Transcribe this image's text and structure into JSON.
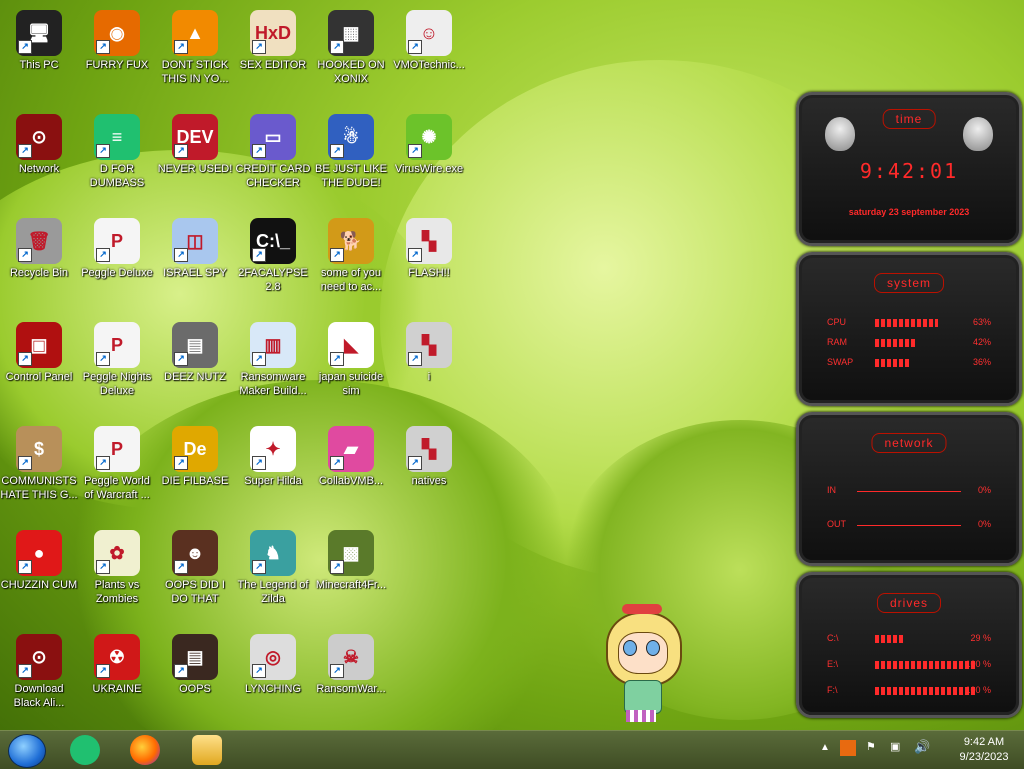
{
  "icons": [
    {
      "label": "This PC",
      "col": 0,
      "row": 0,
      "color": "#222",
      "glyph": "🖥"
    },
    {
      "label": "FURRY FUX",
      "col": 1,
      "row": 0,
      "color": "#e66a00",
      "glyph": "◉"
    },
    {
      "label": "DONT STICK THIS IN YO...",
      "col": 2,
      "row": 0,
      "color": "#f28a00",
      "glyph": "▲"
    },
    {
      "label": "SEX EDITOR",
      "col": 3,
      "row": 0,
      "color": "#f0e0c0",
      "glyph": "HxD"
    },
    {
      "label": "HOOKED ON XONIX",
      "col": 4,
      "row": 0,
      "color": "#333",
      "glyph": "▦"
    },
    {
      "label": "VMOTechnic...",
      "col": 5,
      "row": 0,
      "color": "#eee",
      "glyph": "☺"
    },
    {
      "label": "Network",
      "col": 0,
      "row": 1,
      "color": "#8a1010",
      "glyph": "⊙"
    },
    {
      "label": "D FOR DUMBASS",
      "col": 1,
      "row": 1,
      "color": "#20c070",
      "glyph": "≡"
    },
    {
      "label": "NEVER USED!",
      "col": 2,
      "row": 1,
      "color": "#c01a2a",
      "glyph": "DEV"
    },
    {
      "label": "CREDIT CARD CHECKER",
      "col": 3,
      "row": 1,
      "color": "#6a5acd",
      "glyph": "▭"
    },
    {
      "label": "BE JUST LIKE THE DUDE!",
      "col": 4,
      "row": 1,
      "color": "#3060c0",
      "glyph": "☃"
    },
    {
      "label": "VirusWire.exe",
      "col": 5,
      "row": 1,
      "color": "#6cc32a",
      "glyph": "✺"
    },
    {
      "label": "Recycle Bin",
      "col": 0,
      "row": 2,
      "color": "#9a9a9a",
      "glyph": "🗑"
    },
    {
      "label": "Peggle Deluxe",
      "col": 1,
      "row": 2,
      "color": "#f5f5f5",
      "glyph": "P"
    },
    {
      "label": "ISRAEL SPY",
      "col": 2,
      "row": 2,
      "color": "#a9c7ee",
      "glyph": "◫"
    },
    {
      "label": "2FACALYPSE 2.8",
      "col": 3,
      "row": 2,
      "color": "#111",
      "glyph": "C:\\_"
    },
    {
      "label": "some of you need to ac...",
      "col": 4,
      "row": 2,
      "color": "#d29a18",
      "glyph": "🐕"
    },
    {
      "label": "FLASH!!",
      "col": 5,
      "row": 2,
      "color": "#e8e8e8",
      "glyph": "▚"
    },
    {
      "label": "Control Panel",
      "col": 0,
      "row": 3,
      "color": "#b01010",
      "glyph": "▣"
    },
    {
      "label": "Peggle Nights Deluxe",
      "col": 1,
      "row": 3,
      "color": "#f5f5f5",
      "glyph": "P"
    },
    {
      "label": "DEEZ NUTZ",
      "col": 2,
      "row": 3,
      "color": "#6b6b6b",
      "glyph": "▤"
    },
    {
      "label": "Ransomware Maker Build...",
      "col": 3,
      "row": 3,
      "color": "#d8e8f8",
      "glyph": "▥"
    },
    {
      "label": "japan suicide sim",
      "col": 4,
      "row": 3,
      "color": "#fff",
      "glyph": "◣"
    },
    {
      "label": "i",
      "col": 5,
      "row": 3,
      "color": "#d0d0d0",
      "glyph": "▚"
    },
    {
      "label": "COMMUNISTS HATE THIS G...",
      "col": 0,
      "row": 4,
      "color": "#b8905a",
      "glyph": "$"
    },
    {
      "label": "Peggle World of Warcraft ...",
      "col": 1,
      "row": 4,
      "color": "#f5f5f5",
      "glyph": "P"
    },
    {
      "label": "DIE FILBASE",
      "col": 2,
      "row": 4,
      "color": "#e0a800",
      "glyph": "De"
    },
    {
      "label": "Super Hilda",
      "col": 3,
      "row": 4,
      "color": "#fff",
      "glyph": "✦"
    },
    {
      "label": "CollabVMB...",
      "col": 4,
      "row": 4,
      "color": "#e04aa0",
      "glyph": "▰"
    },
    {
      "label": "natives",
      "col": 5,
      "row": 4,
      "color": "#d0d0d0",
      "glyph": "▚"
    },
    {
      "label": "CHUZZIN CUM",
      "col": 0,
      "row": 5,
      "color": "#e01818",
      "glyph": "●"
    },
    {
      "label": "Plants vs Zombies",
      "col": 1,
      "row": 5,
      "color": "#f0f0d0",
      "glyph": "✿"
    },
    {
      "label": "OOPS DID I DO THAT",
      "col": 2,
      "row": 5,
      "color": "#5a3020",
      "glyph": "☻"
    },
    {
      "label": "The Legend of Zilda",
      "col": 3,
      "row": 5,
      "color": "#3aa0a0",
      "glyph": "♞"
    },
    {
      "label": "Minecraft4Fr...",
      "col": 4,
      "row": 5,
      "color": "#5a7a2a",
      "glyph": "▩"
    },
    {
      "label": "Download Black Ali...",
      "col": 0,
      "row": 6,
      "color": "#8a1010",
      "glyph": "⊙"
    },
    {
      "label": "UKRAINE",
      "col": 1,
      "row": 6,
      "color": "#d01818",
      "glyph": "☢"
    },
    {
      "label": "OOPS",
      "col": 2,
      "row": 6,
      "color": "#3a2820",
      "glyph": "▤"
    },
    {
      "label": "LYNCHING",
      "col": 3,
      "row": 6,
      "color": "#ddd",
      "glyph": "◎"
    },
    {
      "label": "RansomWar...",
      "col": 4,
      "row": 6,
      "color": "#ccc",
      "glyph": "☠"
    }
  ],
  "gadget": {
    "time": {
      "title": "time",
      "clock": "9:42:01",
      "date": "saturday 23 september 2023"
    },
    "system": {
      "title": "system",
      "rows": [
        {
          "label": "CPU",
          "pct": "63%",
          "fill": 0.63
        },
        {
          "label": "RAM",
          "pct": "42%",
          "fill": 0.42
        },
        {
          "label": "SWAP",
          "pct": "36%",
          "fill": 0.36
        }
      ]
    },
    "network": {
      "title": "network",
      "in_label": "IN",
      "in_pct": "0%",
      "out_label": "OUT",
      "out_pct": "0%"
    },
    "drives": {
      "title": "drives",
      "rows": [
        {
          "label": "C:\\",
          "pct": "29 %",
          "fill": 0.29
        },
        {
          "label": "E:\\",
          "pct": "100 %",
          "fill": 1.0
        },
        {
          "label": "F:\\",
          "pct": "100 %",
          "fill": 1.0
        }
      ]
    }
  },
  "taskbar": {
    "clock_time": "9:42 AM",
    "clock_date": "9/23/2023",
    "apps": [
      "start-orb",
      "notes-app",
      "firefox",
      "file-explorer"
    ]
  },
  "colors": {
    "accent": "#ff2a2a",
    "taskbar": "#4a5a2e"
  }
}
